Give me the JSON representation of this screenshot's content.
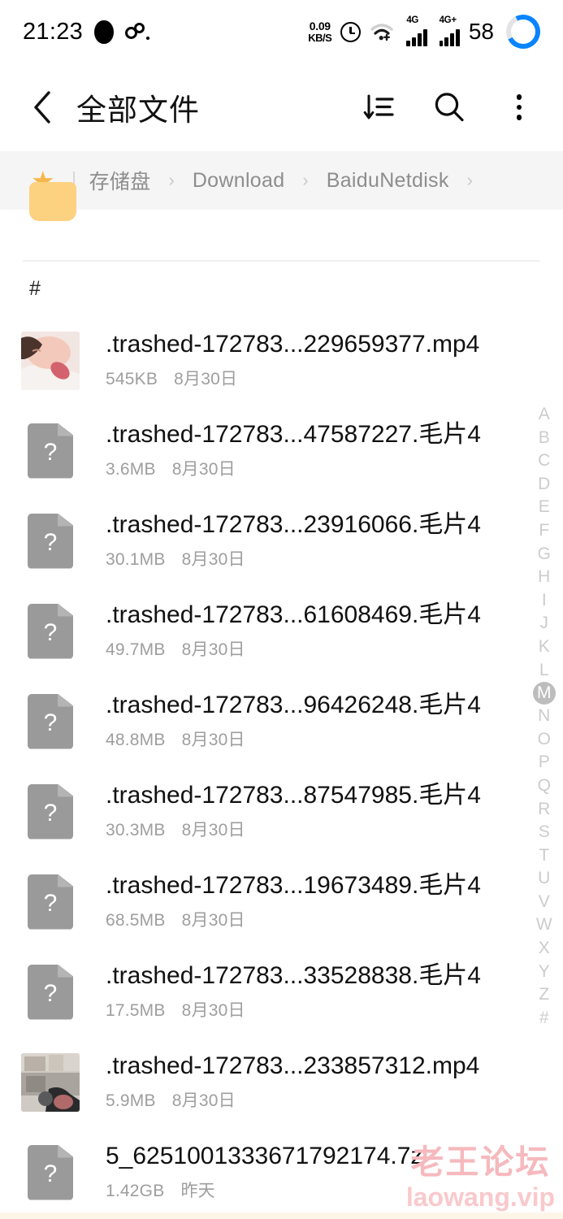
{
  "status_bar": {
    "time": "21:23",
    "left_icons": [
      "camera-punch-hole",
      "dual-circle-glyph"
    ],
    "net_speed_value": "0.09",
    "net_speed_unit": "KB/S",
    "alarm_icon": "alarm-clock-icon",
    "wifi_icon": "wifi-icon",
    "sim1_label": "4G",
    "sim2_label": "4G+",
    "battery_percent": "58",
    "battery_ring_color": "#0a84ff"
  },
  "header": {
    "back_icon": "chevron-left-icon",
    "title": "全部文件",
    "sort_icon": "sort-descending-icon",
    "search_icon": "search-icon",
    "more_icon": "more-vertical-icon"
  },
  "breadcrumb": {
    "star_icon": "★",
    "items": [
      "存储盘",
      "Download",
      "BaiduNetdisk"
    ],
    "separator": "›"
  },
  "section": {
    "header_label": "#"
  },
  "files": [
    {
      "name": ".trashed-172783...229659377.mp4",
      "size": "545KB",
      "date": "8月30日",
      "icon": "video-thumbnail",
      "thumb": "person-sleeping"
    },
    {
      "name": ".trashed-172783...47587227.毛片4",
      "size": "3.6MB",
      "date": "8月30日",
      "icon": "unknown-file-icon"
    },
    {
      "name": ".trashed-172783...23916066.毛片4",
      "size": "30.1MB",
      "date": "8月30日",
      "icon": "unknown-file-icon"
    },
    {
      "name": ".trashed-172783...61608469.毛片4",
      "size": "49.7MB",
      "date": "8月30日",
      "icon": "unknown-file-icon"
    },
    {
      "name": ".trashed-172783...96426248.毛片4",
      "size": "48.8MB",
      "date": "8月30日",
      "icon": "unknown-file-icon"
    },
    {
      "name": ".trashed-172783...87547985.毛片4",
      "size": "30.3MB",
      "date": "8月30日",
      "icon": "unknown-file-icon"
    },
    {
      "name": ".trashed-172783...19673489.毛片4",
      "size": "68.5MB",
      "date": "8月30日",
      "icon": "unknown-file-icon"
    },
    {
      "name": ".trashed-172783...33528838.毛片4",
      "size": "17.5MB",
      "date": "8月30日",
      "icon": "unknown-file-icon"
    },
    {
      "name": ".trashed-172783...233857312.mp4",
      "size": "5.9MB",
      "date": "8月30日",
      "icon": "video-thumbnail",
      "thumb": "room-interior"
    },
    {
      "name": "5_6251001333671792174.7z",
      "size": "1.42GB",
      "date": "昨天",
      "icon": "unknown-file-icon"
    }
  ],
  "alpha_index": {
    "letters": [
      "A",
      "B",
      "C",
      "D",
      "E",
      "F",
      "G",
      "H",
      "I",
      "J",
      "K",
      "L",
      "M",
      "N",
      "O",
      "P",
      "Q",
      "R",
      "S",
      "T",
      "U",
      "V",
      "W",
      "X",
      "Y",
      "Z",
      "#"
    ],
    "active": "M"
  },
  "watermark": {
    "cn": "老王论坛",
    "en": "laowang.vip",
    "color": "#f6b9bd"
  }
}
